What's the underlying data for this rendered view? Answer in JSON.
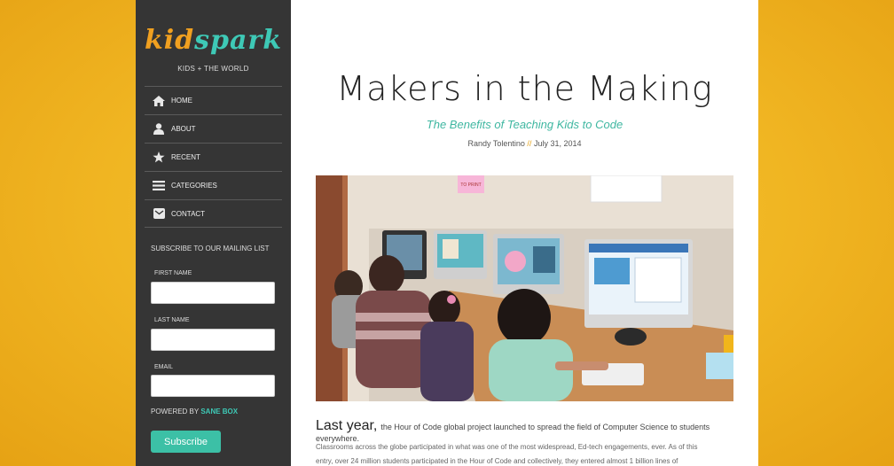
{
  "sidebar": {
    "logo_part1": "kid",
    "logo_part2": "spark",
    "tagline": "KIDS + THE WORLD",
    "nav": [
      {
        "label": "HOME",
        "icon": "home-icon"
      },
      {
        "label": "ABOUT",
        "icon": "user-icon"
      },
      {
        "label": "RECENT",
        "icon": "star-icon"
      },
      {
        "label": "CATEGORIES",
        "icon": "menu-icon"
      },
      {
        "label": "CONTACT",
        "icon": "mail-icon"
      }
    ],
    "subscribe_title": "SUBSCRIBE TO OUR MAILING LIST",
    "fields": {
      "first_name": "FIRST NAME",
      "last_name": "LAST NAME",
      "email": "EMAIL"
    },
    "powered_by": "POWERED BY",
    "powered_brand": "SANE BOX",
    "subscribe_button": "Subscribe"
  },
  "article": {
    "title": "Makers in the Making",
    "subtitle": "The Benefits of Teaching Kids to Code",
    "author": "Randy Tolentino",
    "separator": "//",
    "date": "July 31, 2014",
    "photo_note": "TO PRINT",
    "lead_big": "Last year,",
    "lead_rest": "the Hour of Code global project launched to spread the field of Computer Science to students everywhere.",
    "line2": "Classrooms across the globe participated in what was one of the most widespread, Ed-tech engagements, ever. As of this",
    "line3": "entry, over 24 million students participated in the Hour of Code and collectively, they entered almost 1 billion lines of"
  },
  "colors": {
    "accent": "#3ec9b6",
    "brand_orange": "#f0a020",
    "sidebar_bg": "#353535",
    "background": "#f0b522"
  }
}
